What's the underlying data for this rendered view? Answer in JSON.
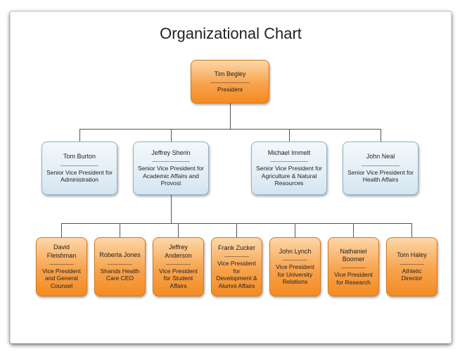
{
  "chart_data": {
    "type": "org-chart",
    "title": "Organizational Chart",
    "colors": {
      "tier1": "#f7a34d",
      "tier2": "#e3eef5",
      "tier3": "#f7a34d"
    },
    "root": {
      "name": "Tim Begley",
      "role": "President"
    },
    "tier2": [
      {
        "name": "Tom Burton",
        "role": "Senior Vice President for Administration"
      },
      {
        "name": "Jeffrey Sherin",
        "role": "Senior Vice President for Academic Affairs and Provost"
      },
      {
        "name": "Michael Immelt",
        "role": "Senior Vice President for Agriculture & Natural Resources"
      },
      {
        "name": "John Neal",
        "role": "Senior Vice President for Health Affairs"
      }
    ],
    "tier3_parent": "Jeffrey Sherin",
    "tier3": [
      {
        "name": "David Fleishman",
        "role": "Vice President and General Counsel"
      },
      {
        "name": "Roberta Jones",
        "role": "Shands Health Care CEO"
      },
      {
        "name": "Jeffrey Anderson",
        "role": "Vice President for Student Affairs"
      },
      {
        "name": "Frank Zucker",
        "role": "Vice President for Development & Alumni Affairs"
      },
      {
        "name": "John Lynch",
        "role": "Vice President for University Relations"
      },
      {
        "name": "Nathaniel Boomer",
        "role": "Vice President for Research"
      },
      {
        "name": "Tom Haley",
        "role": "Athletic Director"
      }
    ]
  }
}
